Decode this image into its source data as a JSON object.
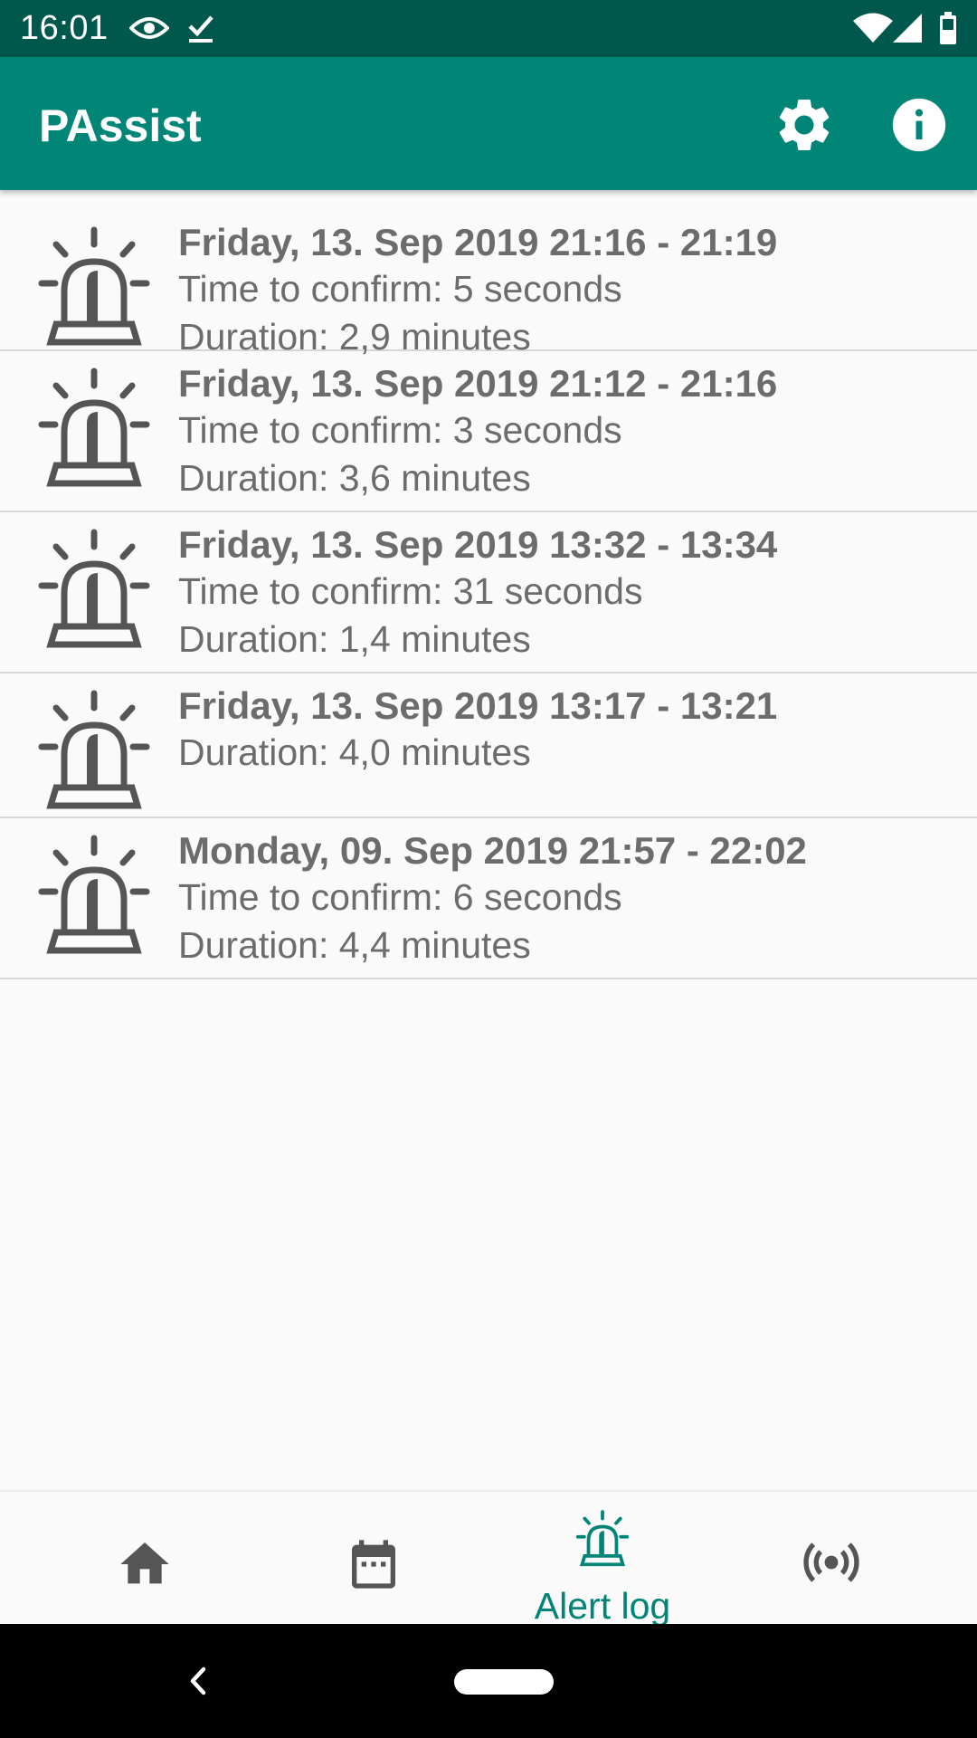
{
  "status_bar": {
    "time": "16:01",
    "icons": [
      "eye-icon",
      "download-done-icon",
      "wifi-icon",
      "signal-icon",
      "battery-icon"
    ]
  },
  "app_bar": {
    "title": "PAssist",
    "actions": [
      "settings-gear-icon",
      "info-icon"
    ]
  },
  "alerts": [
    {
      "title": "Friday, 13. Sep 2019 21:16 - 21:19",
      "lines": [
        "Time to confirm: 5 seconds",
        "Duration: 2,9 minutes"
      ]
    },
    {
      "title": "Friday, 13. Sep 2019 21:12 - 21:16",
      "lines": [
        "Time to confirm: 3 seconds",
        "Duration: 3,6 minutes"
      ]
    },
    {
      "title": "Friday, 13. Sep 2019 13:32 - 13:34",
      "lines": [
        "Time to confirm: 31 seconds",
        "Duration: 1,4 minutes"
      ]
    },
    {
      "title": "Friday, 13. Sep 2019 13:17 - 13:21",
      "lines": [
        "Duration: 4,0 minutes"
      ]
    },
    {
      "title": "Monday, 09. Sep 2019 21:57 - 22:02",
      "lines": [
        "Time to confirm: 6 seconds",
        "Duration: 4,4 minutes"
      ]
    }
  ],
  "bottom_nav": {
    "items": [
      "home-icon",
      "calendar-icon",
      "alert-log-icon",
      "broadcast-icon"
    ],
    "active_label": "Alert log",
    "active_index": 2
  },
  "colors": {
    "status_bar": "#00574b",
    "app_bar": "#008577",
    "accent": "#008577",
    "text_secondary": "#6c6c6c",
    "icon_gray": "#555555"
  }
}
